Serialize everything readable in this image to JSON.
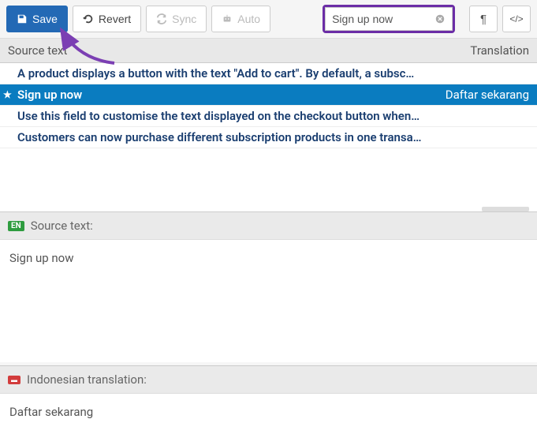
{
  "toolbar": {
    "save_label": "Save",
    "revert_label": "Revert",
    "sync_label": "Sync",
    "auto_label": "Auto",
    "search_value": "Sign up now",
    "pilcrow": "¶",
    "code": "</>"
  },
  "columns": {
    "source": "Source text",
    "translation": "Translation"
  },
  "rows": [
    {
      "src": "A product displays a button with the text \"Add to cart\". By default, a subsc…",
      "trn": "",
      "selected": false
    },
    {
      "src": "Sign up now",
      "trn": "Daftar sekarang",
      "selected": true,
      "star": true
    },
    {
      "src": "Use this field to customise the text displayed on the checkout button when…",
      "trn": "",
      "selected": false
    },
    {
      "src": "Customers can now purchase different subscription products in one transa…",
      "trn": "",
      "selected": false
    }
  ],
  "source_pane": {
    "badge": "EN",
    "label": "Source text:",
    "value": "Sign up now"
  },
  "translation_pane": {
    "badge": "▬",
    "label": "Indonesian translation:",
    "value": "Daftar sekarang"
  }
}
